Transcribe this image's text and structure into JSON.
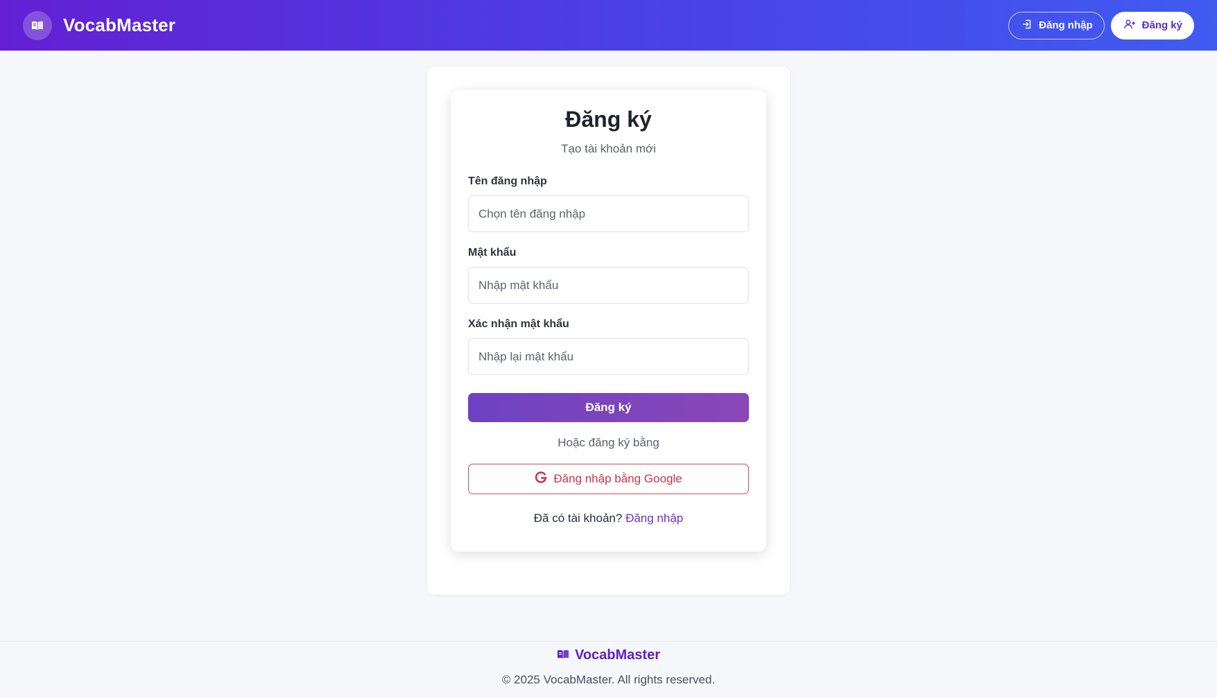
{
  "header": {
    "brand": "VocabMaster",
    "login_label": "Đăng nhập",
    "register_label": "Đăng ký"
  },
  "form": {
    "title": "Đăng ký",
    "subtitle": "Tạo tài khoản mới",
    "username_label": "Tên đăng nhập",
    "username_placeholder": "Chọn tên đăng nhập",
    "username_value": "",
    "password_label": "Mật khẩu",
    "password_placeholder": "Nhập mật khẩu",
    "password_value": "",
    "confirm_label": "Xác nhận mật khẩu",
    "confirm_placeholder": "Nhập lại mật khẩu",
    "confirm_value": "",
    "submit_label": "Đăng ký",
    "divider_text": "Hoặc đăng ký bằng",
    "google_label": "Đăng nhập bằng Google",
    "have_account_text": "Đã có tài khoản?",
    "login_link": "Đăng nhập"
  },
  "footer": {
    "brand": "VocabMaster",
    "copyright": "© 2025 VocabMaster. All rights reserved."
  },
  "icons": {
    "brand": "book-open-icon",
    "login": "sign-in-icon",
    "register": "user-plus-icon",
    "google": "google-icon",
    "footer_brand": "book-open-icon"
  },
  "colors": {
    "header_start": "#6320d3",
    "header_end": "#3f5bf0",
    "accent": "#6a2fcf",
    "google_red": "#cc3545"
  }
}
